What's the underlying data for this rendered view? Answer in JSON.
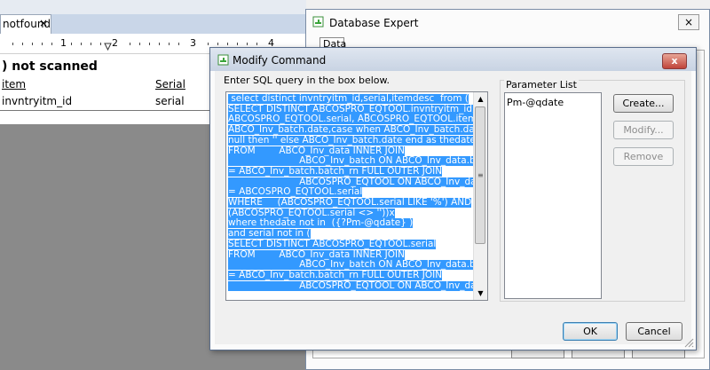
{
  "designer": {
    "tab_label": "notfound",
    "tab_close": "×",
    "ruler_numbers": [
      "1",
      "2",
      "3",
      "4"
    ],
    "report_title": ") not scanned",
    "column_headers": [
      "item",
      "Serial"
    ],
    "column_fields": [
      "invntryitm_id",
      "serial"
    ]
  },
  "database_expert": {
    "title": "Database Expert",
    "tab_label": "Data",
    "close": "×"
  },
  "modify_command": {
    "title": "Modify Command",
    "close": "x",
    "prompt": "Enter SQL query in the box below.",
    "sql_lines": [
      " select distinct invntryitm_id,serial,itemdesc  from (",
      "SELECT DISTINCT ABCOSPRO_EQTOOL.invntryitm_id,",
      "ABCOSPRO_EQTOOL.serial, ABCOSPRO_EQTOOL.itemdesc,",
      "ABCO_Inv_batch.date,case when ABCO_Inv_batch.date is",
      "null then '' else ABCO_Inv_batch.date end as thedate",
      "FROM        ABCO_Inv_data INNER JOIN",
      "                        ABCO_Inv_batch ON ABCO_Inv_data.batch_rn",
      "= ABCO_Inv_batch.batch_rn FULL OUTER JOIN",
      "                        ABCOSPRO_EQTOOL ON ABCO_Inv_data.serial",
      "= ABCOSPRO_EQTOOL.serial",
      "WHERE     (ABCOSPRO_EQTOOL.serial LIKE '%') AND",
      "(ABCOSPRO_EQTOOL.serial <> ''))x",
      "where thedate not in  ({?Pm-@qdate} )",
      "and serial not in (",
      "SELECT DISTINCT ABCOSPRO_EQTOOL.serial",
      "FROM        ABCO_Inv_data INNER JOIN",
      "                        ABCO_Inv_batch ON ABCO_Inv_data.batch_rn",
      "= ABCO_Inv_batch.batch_rn FULL OUTER JOIN",
      "                        ABCOSPRO_EQTOOL ON ABCO_Inv_data.serial"
    ],
    "parameter_list_label": "Parameter List",
    "parameters": [
      "Pm-@qdate"
    ],
    "buttons": {
      "create": "Create...",
      "modify": "Modify...",
      "remove": "Remove",
      "ok": "OK",
      "cancel": "Cancel"
    },
    "scroll_up_glyph": "▲",
    "scroll_down_glyph": "▼",
    "scroll_grip_glyph": "≡"
  },
  "colors": {
    "selection": "#3399ff",
    "title_bar": "#c8d3e3",
    "close_button": "#c0443a"
  }
}
